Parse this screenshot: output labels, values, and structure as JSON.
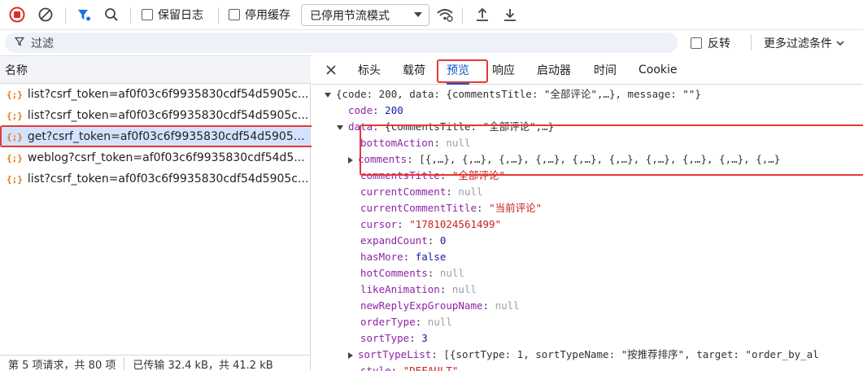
{
  "toolbar": {
    "preserve_log": "保留日志",
    "disable_cache": "停用缓存",
    "throttling": "已停用节流模式"
  },
  "filter": {
    "placeholder": "过滤",
    "invert": "反转",
    "more_filters": "更多过滤条件"
  },
  "requests": {
    "column_header": "名称",
    "items": [
      {
        "name": "list?csrf_token=af0f03c6f9935830cdf54d5905c..."
      },
      {
        "name": "list?csrf_token=af0f03c6f9935830cdf54d5905c..."
      },
      {
        "name": "get?csrf_token=af0f03c6f9935830cdf54d5905c..."
      },
      {
        "name": "weblog?csrf_token=af0f03c6f9935830cdf54d5..."
      },
      {
        "name": "list?csrf_token=af0f03c6f9935830cdf54d5905c..."
      }
    ],
    "selected_index": 2,
    "status_left": "第 5 项请求，共 80 项",
    "status_right": "已传输 32.4 kB，共 41.2 kB"
  },
  "detail_tabs": {
    "headers": "标头",
    "payload": "载荷",
    "preview": "预览",
    "response": "响应",
    "initiator": "启动器",
    "timing": "时间",
    "cookie": "Cookie",
    "active": "预览"
  },
  "preview": {
    "root": "{code: 200, data: {commentsTitle: \"全部评论\",…}, message: \"\"}",
    "code_key": "code",
    "code_val": "200",
    "data_key": "data",
    "data_summary": "{commentsTitle: \"全部评论\",…}",
    "fields": [
      {
        "key": "bottomAction",
        "value": "null",
        "kind": "null"
      },
      {
        "key": "comments",
        "value": "[{,…}, {,…}, {,…}, {,…}, {,…}, {,…}, {,…}, {,…}, {,…}, {,…}",
        "kind": "array"
      },
      {
        "key": "commentsTitle",
        "value": "\"全部评论\"",
        "kind": "string"
      },
      {
        "key": "currentComment",
        "value": "null",
        "kind": "null"
      },
      {
        "key": "currentCommentTitle",
        "value": "\"当前评论\"",
        "kind": "string"
      },
      {
        "key": "cursor",
        "value": "\"1781024561499\"",
        "kind": "string"
      },
      {
        "key": "expandCount",
        "value": "0",
        "kind": "number"
      },
      {
        "key": "hasMore",
        "value": "false",
        "kind": "bool"
      },
      {
        "key": "hotComments",
        "value": "null",
        "kind": "null"
      },
      {
        "key": "likeAnimation",
        "value": "null",
        "kind": "null"
      },
      {
        "key": "newReplyExpGroupName",
        "value": "null",
        "kind": "null"
      },
      {
        "key": "orderType",
        "value": "null",
        "kind": "null"
      },
      {
        "key": "sortType",
        "value": "3",
        "kind": "number"
      },
      {
        "key": "sortTypeList",
        "value": "[{sortType: 1, sortTypeName: \"按推荐排序\", target: \"order_by_al",
        "kind": "array"
      },
      {
        "key": "style",
        "value": "\"DEFAULT\"",
        "kind": "string"
      }
    ]
  },
  "colors": {
    "accent": "#0b57d0",
    "selected_row": "#d3e3fd",
    "highlight_box": "#e53935",
    "record_red": "#d93025"
  }
}
